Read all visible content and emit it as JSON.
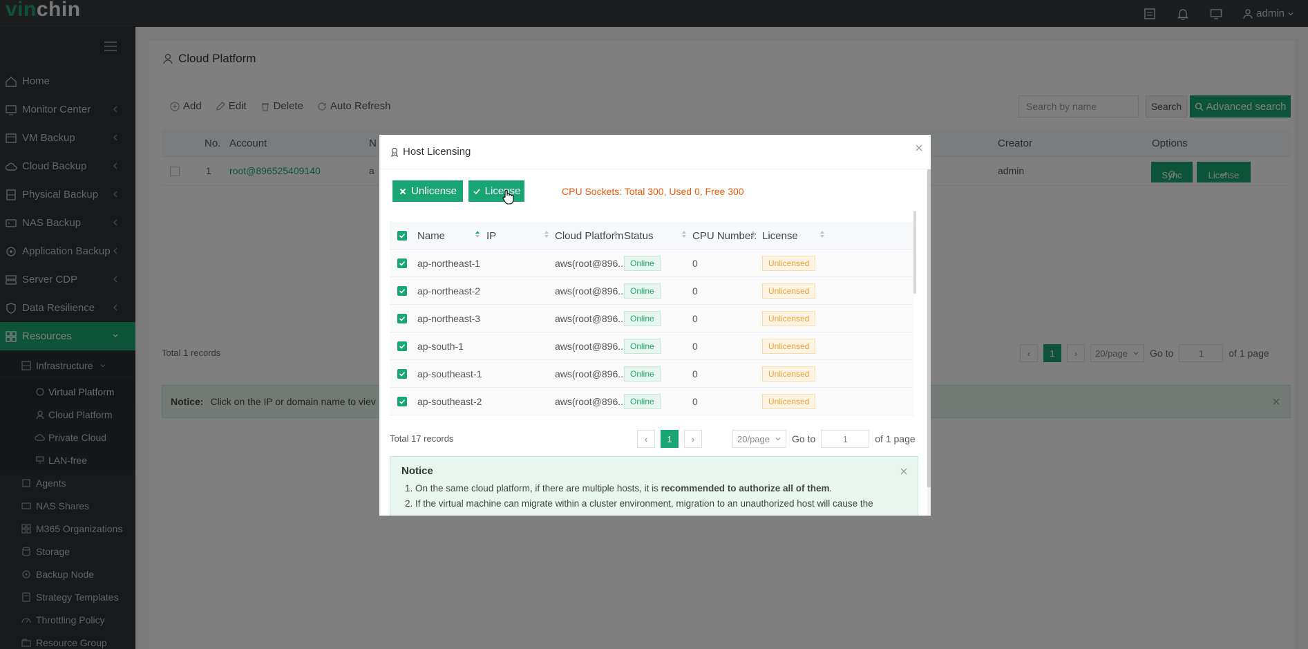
{
  "brand": {
    "logo_a": "vin",
    "logo_b": "chin"
  },
  "topbar": {
    "user": "admin",
    "icons": [
      "list-icon",
      "bell-icon",
      "monitor-icon",
      "user-icon"
    ]
  },
  "sidebar": {
    "items": [
      {
        "label": "Home",
        "icon": "home-icon"
      },
      {
        "label": "Monitor Center",
        "icon": "monitor-icon"
      },
      {
        "label": "VM Backup",
        "icon": "vm-icon"
      },
      {
        "label": "Cloud Backup",
        "icon": "cloud-icon"
      },
      {
        "label": "Physical Backup",
        "icon": "server-icon"
      },
      {
        "label": "NAS Backup",
        "icon": "nas-icon"
      },
      {
        "label": "Application Backup",
        "icon": "app-icon"
      },
      {
        "label": "Server CDP",
        "icon": "cdp-icon"
      },
      {
        "label": "Data Resilience",
        "icon": "shield-icon"
      },
      {
        "label": "Resources",
        "icon": "grid-icon"
      }
    ],
    "infrastructure": "Infrastructure",
    "infra_children": [
      "Virtual Platform",
      "Cloud Platform",
      "Private Cloud",
      "LAN-free"
    ],
    "resources_children": [
      "Agents",
      "NAS Shares",
      "M365 Organizations",
      "Storage",
      "Backup Node",
      "Strategy Templates",
      "Throttling Policy",
      "Resource Group"
    ]
  },
  "page": {
    "title": "Cloud Platform",
    "toolbar": {
      "add": "Add",
      "edit": "Edit",
      "delete": "Delete",
      "refresh": "Auto Refresh"
    },
    "search_placeholder": "Search by name",
    "search_btn": "Search",
    "advanced_btn": "Advanced search",
    "table": {
      "headers": {
        "no": "No.",
        "account": "Account",
        "n": "N",
        "creator": "Creator",
        "options": "Options"
      },
      "row": {
        "no": "1",
        "account": "root@896525409140",
        "partial": "a",
        "creator": "admin"
      },
      "sync": "Sync",
      "license": "License"
    },
    "total": "Total 1 records",
    "pager": {
      "page": "1",
      "size": "20/page",
      "goto": "Go to",
      "goto_val": "1",
      "of": "of 1 page"
    },
    "notice_label": "Notice:",
    "notice_text": "Click on the IP or domain name to viev"
  },
  "modal": {
    "title": "Host Licensing",
    "unlicense_btn": "Unlicense",
    "license_btn": "License",
    "cpu_info": "CPU Sockets: Total 300, Used 0, Free 300",
    "headers": {
      "name": "Name",
      "ip": "IP",
      "cloud": "Cloud Platform",
      "status": "Status",
      "cpu": "CPU Number:",
      "license": "License"
    },
    "rows": [
      {
        "name": "ap-northeast-1",
        "ip": "",
        "cloud": "aws(root@896...",
        "status": "Online",
        "cpu": "0",
        "license": "Unlicensed"
      },
      {
        "name": "ap-northeast-2",
        "ip": "",
        "cloud": "aws(root@896...",
        "status": "Online",
        "cpu": "0",
        "license": "Unlicensed"
      },
      {
        "name": "ap-northeast-3",
        "ip": "",
        "cloud": "aws(root@896...",
        "status": "Online",
        "cpu": "0",
        "license": "Unlicensed"
      },
      {
        "name": "ap-south-1",
        "ip": "",
        "cloud": "aws(root@896...",
        "status": "Online",
        "cpu": "0",
        "license": "Unlicensed"
      },
      {
        "name": "ap-southeast-1",
        "ip": "",
        "cloud": "aws(root@896...",
        "status": "Online",
        "cpu": "0",
        "license": "Unlicensed"
      },
      {
        "name": "ap-southeast-2",
        "ip": "",
        "cloud": "aws(root@896...",
        "status": "Online",
        "cpu": "0",
        "license": "Unlicensed"
      }
    ],
    "total": "Total 17 records",
    "pager": {
      "prev": "‹",
      "page": "1",
      "next": "›",
      "size": "20/page",
      "goto": "Go to",
      "goto_val": "1",
      "of": "of 1 page"
    },
    "notice": {
      "title": "Notice",
      "line1_pre": "1. On the same cloud platform, if there are multiple hosts, it is ",
      "line1_bold": "recommended to authorize all of them",
      "line1_post": ".",
      "line2": "2. If the virtual machine can migrate within a cluster environment, migration to an unauthorized host will cause the"
    }
  },
  "colors": {
    "accent": "#1aa674",
    "warning": "#e6a23c",
    "cpu_text": "#e8590c",
    "sidebar": "#2f3237",
    "topbar": "#393a3c"
  }
}
